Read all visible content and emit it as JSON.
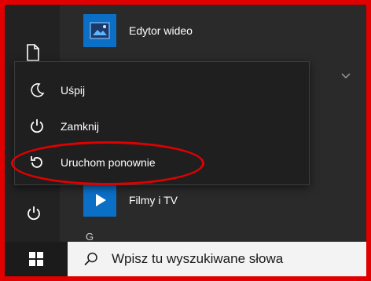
{
  "apps": [
    {
      "label": "Edytor wideo",
      "icon": "video-editor-icon"
    },
    {
      "label": "Filmy i TV",
      "icon": "movies-tv-icon"
    }
  ],
  "group_letter": "G",
  "power_menu": [
    {
      "label": "Uśpij",
      "icon": "moon-icon"
    },
    {
      "label": "Zamknij",
      "icon": "power-icon"
    },
    {
      "label": "Uruchom ponownie",
      "icon": "restart-icon"
    }
  ],
  "taskbar": {
    "search_placeholder": "Wpisz tu wyszukiwane słowa"
  },
  "colors": {
    "highlight": "#e00000",
    "app_tile": "#0b6fc6",
    "flyout_bg": "#1f1f1f",
    "taskbar_bg": "#1b1b1b"
  }
}
